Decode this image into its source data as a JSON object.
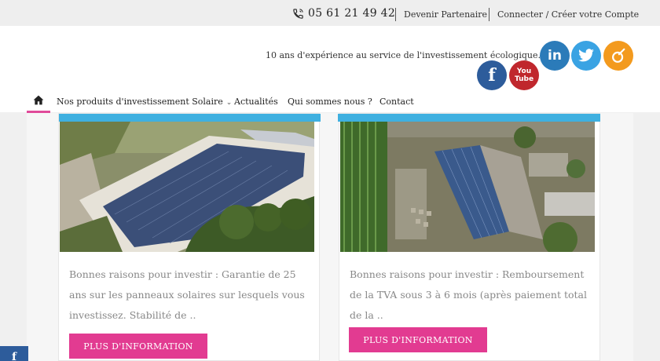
{
  "topbar": {
    "phone": "05 61 21 49 42",
    "partner_link": "Devenir Partenaire",
    "account_link": "Connecter / Créer votre Compte"
  },
  "header": {
    "tagline": "10 ans d'expérience au service de l'investissement écologique.",
    "social": {
      "linkedin": "in",
      "facebook": "f",
      "youtube_top": "You",
      "youtube_bottom": "Tube"
    }
  },
  "nav": {
    "items": [
      {
        "label": "Nos produits d'investissement Solaire",
        "has_dropdown": true
      },
      {
        "label": "Actualités"
      },
      {
        "label": "Qui sommes nous ?"
      },
      {
        "label": "Contact"
      }
    ]
  },
  "cards": [
    {
      "text": "Bonnes raisons pour investir :   Garantie de 25 ans sur les panneaux solaires sur lesquels vous investissez. Stabilité de ..",
      "button": "PLUS D'INFORMATION"
    },
    {
      "text": "Bonnes raisons pour investir :   Remboursement de la TVA sous 3 à 6 mois (après paiement total de la ..",
      "button": "PLUS D'INFORMATION"
    }
  ],
  "floating": {
    "facebook": "f"
  },
  "colors": {
    "accent_pink": "#e23b91",
    "band_blue": "#3fb0e0",
    "linkedin": "#2b7bb9",
    "twitter": "#3aa3e3",
    "viadeo": "#f39a1e",
    "facebook": "#2d5c9b",
    "youtube": "#c0272d"
  }
}
